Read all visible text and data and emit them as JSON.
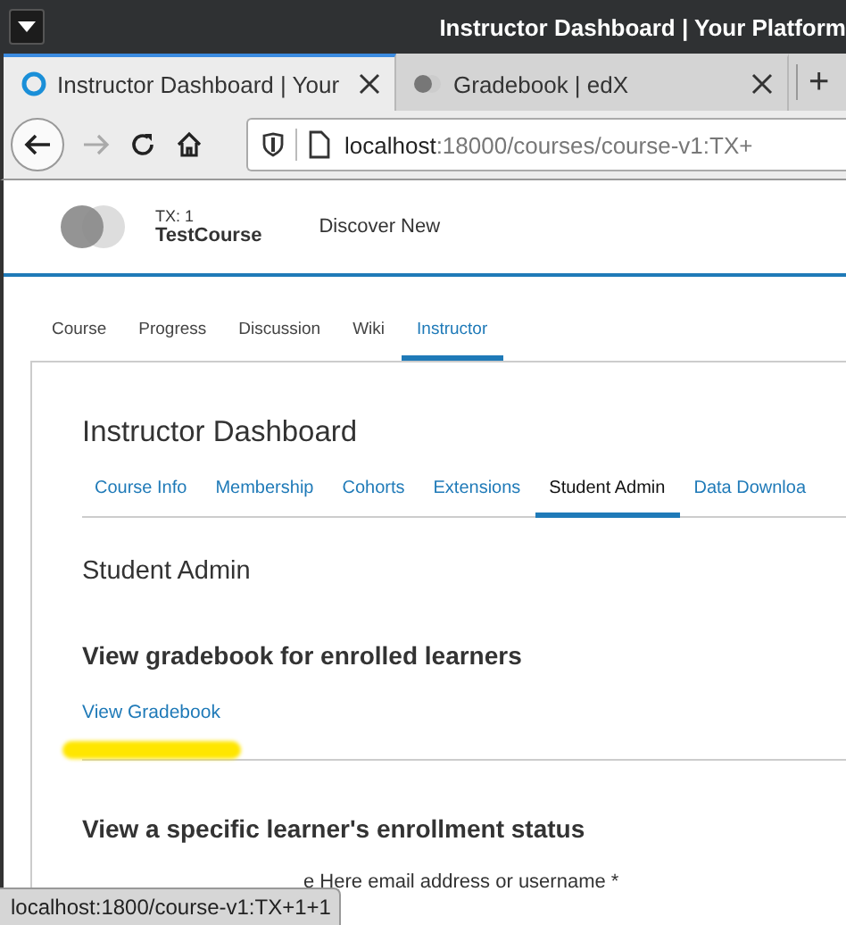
{
  "window": {
    "title": "Instructor Dashboard | Your Platform"
  },
  "browser_tabs": [
    {
      "title": "Instructor Dashboard | Your",
      "selected": true,
      "kind": "loading"
    },
    {
      "title": "Gradebook | edX",
      "selected": false,
      "kind": "dot"
    }
  ],
  "new_tab": "+",
  "address_bar": {
    "host": "localhost",
    "path": ":18000/courses/course-v1:TX+"
  },
  "header": {
    "org": "TX: 1",
    "course": "TestCourse",
    "nav_link": "Discover New"
  },
  "course_tabs": [
    {
      "label": "Course",
      "selected": false
    },
    {
      "label": "Progress",
      "selected": false
    },
    {
      "label": "Discussion",
      "selected": false
    },
    {
      "label": "Wiki",
      "selected": false
    },
    {
      "label": "Instructor",
      "selected": true
    }
  ],
  "dashboard": {
    "title": "Instructor Dashboard",
    "tabs": [
      {
        "label": "Course Info",
        "selected": false
      },
      {
        "label": "Membership",
        "selected": false
      },
      {
        "label": "Cohorts",
        "selected": false
      },
      {
        "label": "Extensions",
        "selected": false
      },
      {
        "label": "Student Admin",
        "selected": true
      },
      {
        "label": "Data Downloa",
        "selected": false
      }
    ],
    "section_title": "Student Admin",
    "gradebook_heading": "View gradebook for enrolled learners",
    "gradebook_link": "View Gradebook",
    "enrollment_heading": "View a specific learner's enrollment status",
    "field_label": "e Here email address or username *"
  },
  "status_bar": "localhost:1800/course-v1:TX+1+1"
}
